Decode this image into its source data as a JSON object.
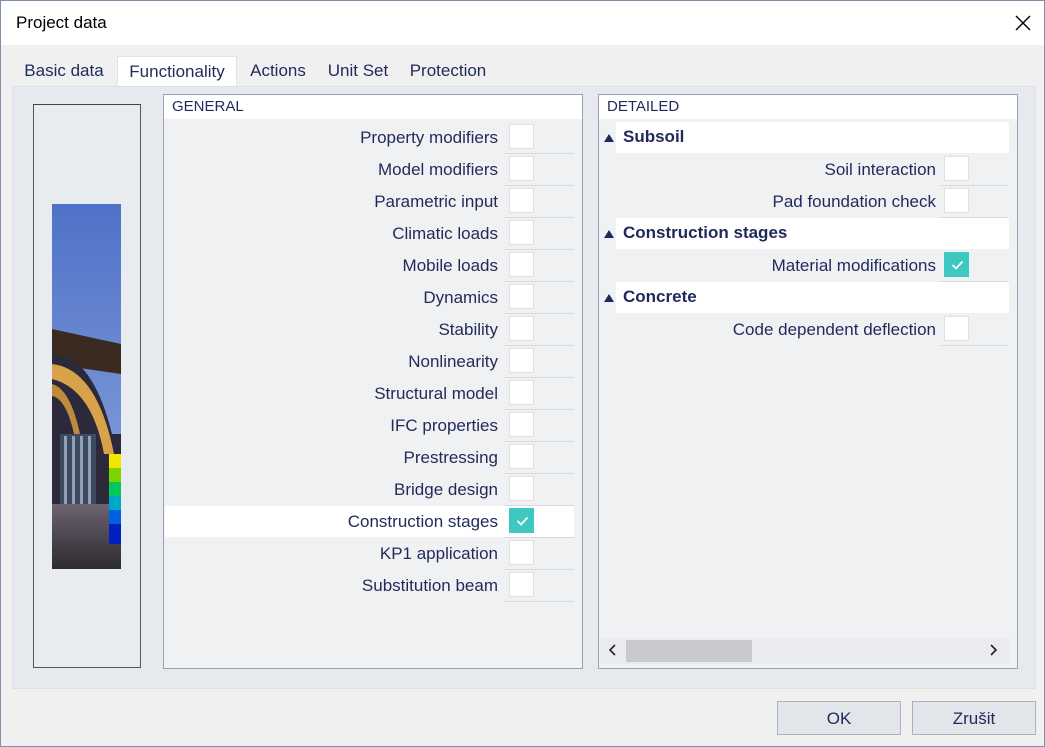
{
  "window": {
    "title": "Project data"
  },
  "tabs": [
    {
      "label": "Basic data",
      "active": false
    },
    {
      "label": "Functionality",
      "active": true
    },
    {
      "label": "Actions",
      "active": false
    },
    {
      "label": "Unit Set",
      "active": false
    },
    {
      "label": "Protection",
      "active": false
    }
  ],
  "general": {
    "header": "GENERAL",
    "items": [
      {
        "label": "Property modifiers",
        "checked": false
      },
      {
        "label": "Model modifiers",
        "checked": false
      },
      {
        "label": "Parametric input",
        "checked": false
      },
      {
        "label": "Climatic loads",
        "checked": false
      },
      {
        "label": "Mobile loads",
        "checked": false
      },
      {
        "label": "Dynamics",
        "checked": false
      },
      {
        "label": "Stability",
        "checked": false
      },
      {
        "label": "Nonlinearity",
        "checked": false
      },
      {
        "label": "Structural model",
        "checked": false
      },
      {
        "label": "IFC properties",
        "checked": false
      },
      {
        "label": "Prestressing",
        "checked": false
      },
      {
        "label": "Bridge design",
        "checked": false
      },
      {
        "label": "Construction stages",
        "checked": true
      },
      {
        "label": "KP1 application",
        "checked": false
      },
      {
        "label": "Substitution beam",
        "checked": false
      }
    ]
  },
  "detailed": {
    "header": "DETAILED",
    "sections": [
      {
        "title": "Subsoil",
        "items": [
          {
            "label": "Soil interaction",
            "checked": false
          },
          {
            "label": "Pad foundation check",
            "checked": false
          }
        ]
      },
      {
        "title": "Construction stages",
        "items": [
          {
            "label": "Material modifications",
            "checked": true
          }
        ]
      },
      {
        "title": "Concrete",
        "items": [
          {
            "label": "Code dependent deflection",
            "checked": false
          }
        ]
      }
    ]
  },
  "buttons": {
    "ok": "OK",
    "cancel": "Zrušit"
  },
  "colors": {
    "accent": "#3ec8c2",
    "text": "#1f2a5a"
  }
}
